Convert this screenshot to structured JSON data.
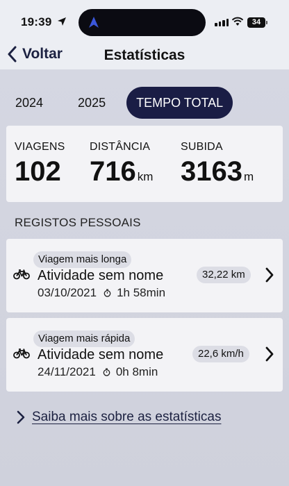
{
  "status_bar": {
    "time": "19:39",
    "battery": "34"
  },
  "nav": {
    "back_label": "Voltar",
    "title": "Estatísticas"
  },
  "tabs": [
    {
      "label": "2024",
      "active": false
    },
    {
      "label": "2025",
      "active": false
    },
    {
      "label": "TEMPO TOTAL",
      "active": true
    }
  ],
  "stats": {
    "trips": {
      "label": "VIAGENS",
      "value": "102"
    },
    "distance": {
      "label": "DISTÂNCIA",
      "value": "716",
      "unit": "km"
    },
    "climb": {
      "label": "SUBIDA",
      "value": "3163",
      "unit": "m"
    }
  },
  "personal_records": {
    "title": "REGISTOS PESSOAIS",
    "items": [
      {
        "badge": "Viagem mais longa",
        "name": "Atividade sem nome",
        "date": "03/10/2021",
        "duration": "1h 58min",
        "value": "32,22 km"
      },
      {
        "badge": "Viagem mais rápida",
        "name": "Atividade sem nome",
        "date": "24/11/2021",
        "duration": "0h 8min",
        "value": "22,6 km/h"
      }
    ]
  },
  "learn_more": {
    "label": "Saiba mais sobre as estatísticas"
  },
  "colors": {
    "accent": "#1a1d45",
    "link": "#1c2141",
    "card": "#f3f3f6",
    "pill": "#dcdde5"
  }
}
